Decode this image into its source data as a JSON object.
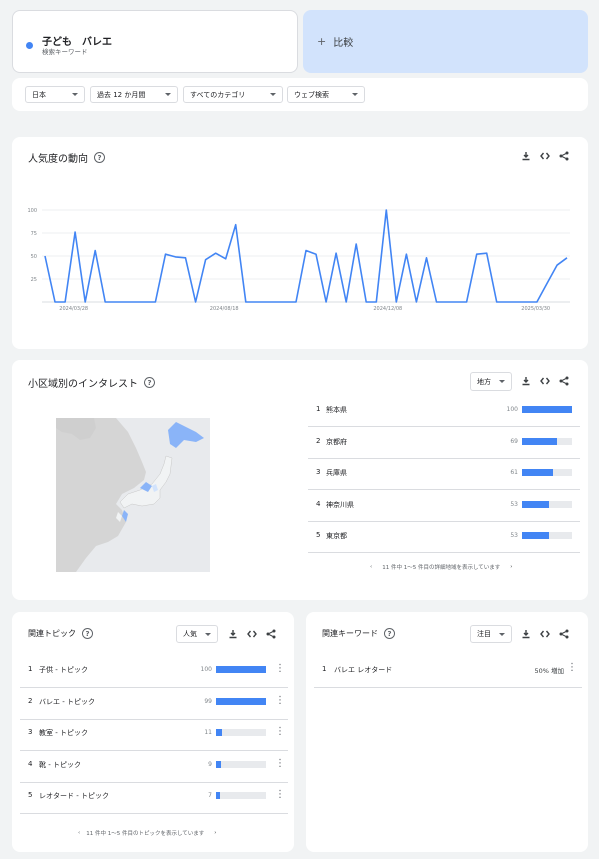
{
  "search": {
    "term": "子ども　バレエ",
    "term_type": "検索キーワード",
    "compare_label": "比較",
    "term_color": "#4285f4"
  },
  "filters": {
    "region": "日本",
    "period": "過去 12 か月間",
    "category": "すべてのカテゴリ",
    "search_type": "ウェブ検索"
  },
  "trend": {
    "title": "人気度の動向"
  },
  "chart_data": {
    "type": "line",
    "title": "",
    "xlabel": "",
    "ylabel": "",
    "ylim": [
      0,
      100
    ],
    "yticks": [
      25,
      50,
      75,
      100
    ],
    "xtick_labels": [
      "2024/03/28",
      "2024/08/18",
      "2024/12/08",
      "2025/03/30"
    ],
    "color": "#4285f4",
    "values": [
      50,
      0,
      0,
      76,
      0,
      56,
      0,
      0,
      0,
      0,
      0,
      0,
      52,
      49,
      48,
      0,
      46,
      53,
      47,
      84,
      0,
      0,
      0,
      0,
      0,
      0,
      56,
      52,
      0,
      53,
      0,
      63,
      0,
      0,
      100,
      0,
      52,
      0,
      48,
      0,
      0,
      0,
      0,
      52,
      53,
      0,
      0,
      0,
      0,
      0,
      20,
      40,
      48
    ]
  },
  "region_panel": {
    "title": "小区域別のインタレスト",
    "level_dropdown": "地方",
    "rows": [
      {
        "rank": "1",
        "name": "熊本県",
        "value": "100",
        "pct": 1.0
      },
      {
        "rank": "2",
        "name": "京都府",
        "value": "69",
        "pct": 0.69
      },
      {
        "rank": "3",
        "name": "兵庫県",
        "value": "61",
        "pct": 0.61
      },
      {
        "rank": "4",
        "name": "神奈川県",
        "value": "53",
        "pct": 0.53
      },
      {
        "rank": "5",
        "name": "東京都",
        "value": "53",
        "pct": 0.53
      }
    ],
    "pager": "11 件中 1～5 件目の詳細地域を表示しています"
  },
  "topics": {
    "title": "関連トピック",
    "sort_dropdown": "人気",
    "rows": [
      {
        "rank": "1",
        "name": "子供 - トピック",
        "value": "100",
        "pct": 1.0
      },
      {
        "rank": "2",
        "name": "バレエ - トピック",
        "value": "99",
        "pct": 0.99
      },
      {
        "rank": "3",
        "name": "教室 - トピック",
        "value": "11",
        "pct": 0.11
      },
      {
        "rank": "4",
        "name": "靴 - トピック",
        "value": "9",
        "pct": 0.09
      },
      {
        "rank": "5",
        "name": "レオタード - トピック",
        "value": "7",
        "pct": 0.07
      }
    ],
    "pager": "11 件中 1～5 件目のトピックを表示しています"
  },
  "queries": {
    "title": "関連キーワード",
    "sort_dropdown": "注目",
    "rows": [
      {
        "rank": "1",
        "name": "バレエ レオタード",
        "value": "50% 増加"
      }
    ]
  }
}
